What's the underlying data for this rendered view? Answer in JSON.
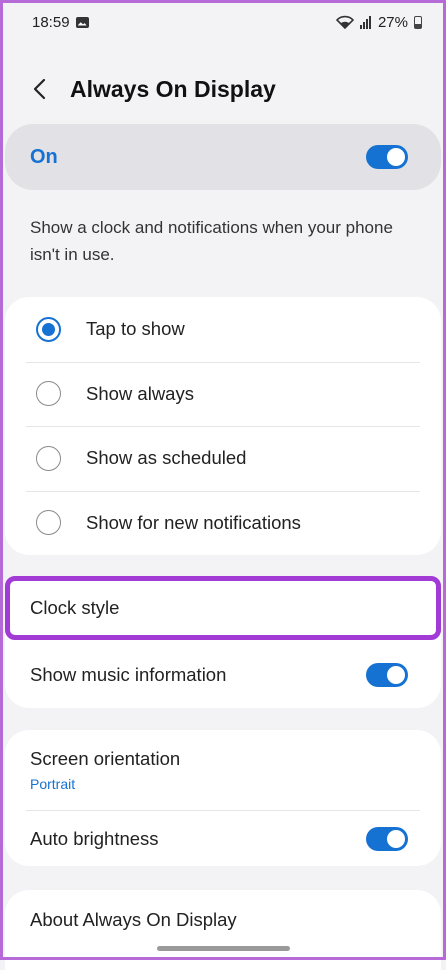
{
  "status_bar": {
    "time": "18:59",
    "battery": "27%",
    "icons": [
      "photo-icon",
      "wifi-icon",
      "signal-icon",
      "battery-icon"
    ]
  },
  "header": {
    "title": "Always On Display",
    "back_icon": "chevron-left-icon"
  },
  "master_switch": {
    "label": "On",
    "enabled": true
  },
  "description": "Show a clock and notifications when your phone isn't in use.",
  "display_mode": {
    "selected": "Tap to show",
    "options": [
      {
        "label": "Tap to show",
        "checked": true
      },
      {
        "label": "Show always",
        "checked": false
      },
      {
        "label": "Show as scheduled",
        "checked": false
      },
      {
        "label": "Show for new notifications",
        "checked": false
      }
    ]
  },
  "settings": {
    "clock_style": "Clock style",
    "music_info": {
      "label": "Show music information",
      "enabled": true
    },
    "screen_orientation": {
      "label": "Screen orientation",
      "value": "Portrait"
    },
    "auto_brightness": {
      "label": "Auto brightness",
      "enabled": true
    },
    "about": "About Always On Display"
  },
  "colors": {
    "accent": "#1572d3",
    "highlight_border": "#a23bd6",
    "frame_border": "#b56ad8",
    "background": "#f3f3f5"
  }
}
